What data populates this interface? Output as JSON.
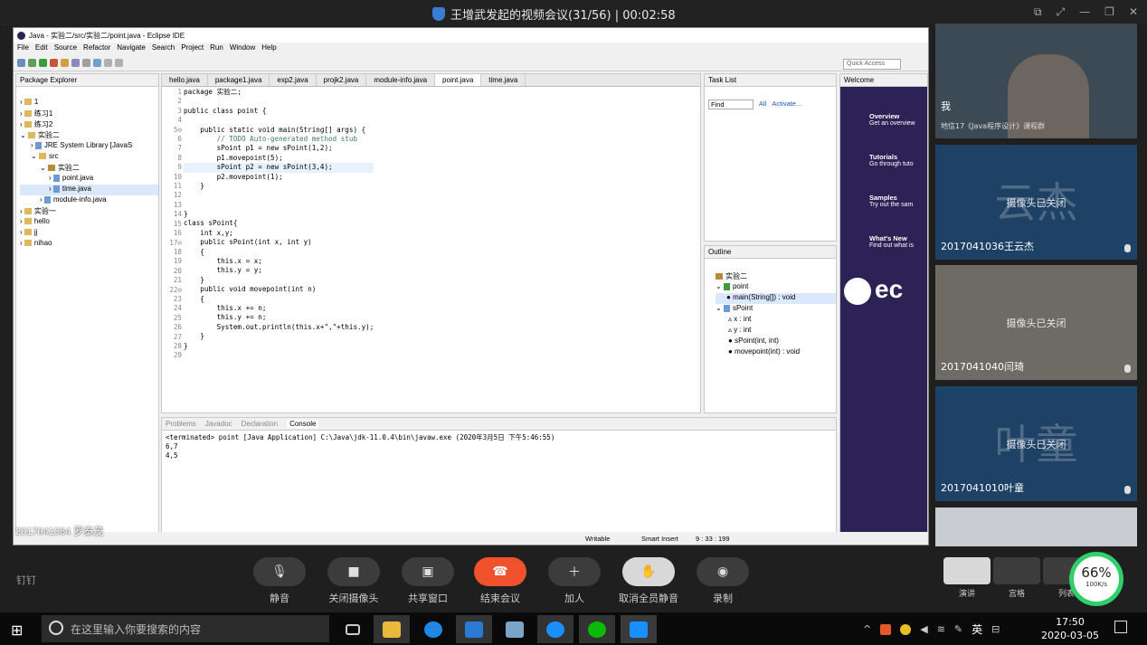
{
  "meeting": {
    "title": "王增武发起的视频会议(31/56) | 00:02:58"
  },
  "eclipse": {
    "window_title": "Java - 实验二/src/实验二/point.java - Eclipse IDE",
    "menu": [
      "File",
      "Edit",
      "Source",
      "Refactor",
      "Navigate",
      "Search",
      "Project",
      "Run",
      "Window",
      "Help"
    ],
    "quick_access": "Quick Access",
    "package_explorer": {
      "title": "Package Explorer",
      "items": [
        "1",
        "练习1",
        "练习2",
        "实验二",
        "JRE System Library [JavaS",
        "src",
        "实验二",
        "point.java",
        "time.java",
        "module-info.java",
        "实验一",
        "hello",
        "jj",
        "nihao"
      ]
    },
    "editor_tabs": [
      "hello.java",
      "package1.java",
      "exp2.java",
      "projk2.java",
      "module-info.java",
      "point.java",
      "time.java"
    ],
    "line_numbers": [
      "1",
      "2",
      "3",
      "4",
      "5⊖",
      "6",
      "7",
      "8",
      "9",
      "10",
      "11",
      "12",
      "13",
      "14",
      "15",
      "16",
      "17⊖",
      "18",
      "19",
      "20",
      "21",
      "22⊖",
      "23",
      "24",
      "25",
      "26",
      "27",
      "28",
      "29"
    ],
    "code": [
      "package 实验二;",
      "",
      "public class point {",
      "",
      "    public static void main(String[] args) {",
      "        // TODO Auto-generated method stub",
      "        sPoint p1 = new sPoint(1,2);",
      "        p1.movepoint(5);",
      "        sPoint p2 = new sPoint(3,4);",
      "        p2.movepoint(1);",
      "    }",
      "",
      "",
      "}",
      "class sPoint{",
      "    int x,y;",
      "    public sPoint(int x, int y)",
      "    {",
      "        this.x = x;",
      "        this.y = y;",
      "    }",
      "    public void movepoint(int n)",
      "    {",
      "        this.x += n;",
      "        this.y += n;",
      "        System.out.println(this.x+\",\"+this.y);",
      "    }",
      "}",
      ""
    ],
    "task_list": {
      "title": "Task List",
      "find": "Find",
      "all": "All",
      "activate": "Activate..."
    },
    "outline": {
      "title": "Outline",
      "items": [
        "实验二",
        "point",
        "main(String[]) : void",
        "sPoint",
        "x : int",
        "y : int",
        "sPoint(int, int)",
        "movepoint(int) : void"
      ]
    },
    "welcome": {
      "title": "Welcome",
      "items": [
        {
          "t": "Overview",
          "d": "Get an overview"
        },
        {
          "t": "Tutorials",
          "d": "Go through tuto"
        },
        {
          "t": "Samples",
          "d": "Try out the sam"
        },
        {
          "t": "What's New",
          "d": "Find out what is"
        }
      ],
      "logo": "ec"
    },
    "bottom_tabs": [
      "Problems",
      "Javadoc",
      "Declaration",
      "Console"
    ],
    "console": {
      "header": "<terminated> point [Java Application] C:\\Java\\jdk-11.0.4\\bin\\javaw.exe (2020年3月5日 下午5:46:55)",
      "lines": [
        "6,7",
        "4,5"
      ]
    },
    "status": {
      "writable": "Writable",
      "insert": "Smart Insert",
      "pos": "9 : 33 : 199"
    }
  },
  "overlay_name": "2017041064 罗泰茂",
  "participants": [
    {
      "name": "我",
      "sub": "地信17《Java程序设计》课程群"
    },
    {
      "name": "2017041036王云杰",
      "big": "云杰",
      "cam": "摄像头已关闭"
    },
    {
      "name": "2017041040闫琦",
      "big": "",
      "cam": "摄像头已关闭"
    },
    {
      "name": "2017041010叶童",
      "big": "叶童",
      "cam": "摄像头已关闭"
    }
  ],
  "controls": [
    {
      "label": "静音",
      "icon": "mic-icon"
    },
    {
      "label": "关闭摄像头",
      "icon": "camera-icon"
    },
    {
      "label": "共享窗口",
      "icon": "share-icon"
    },
    {
      "label": "结束会议",
      "icon": "end-call-icon"
    },
    {
      "label": "加人",
      "icon": "add-person-icon"
    },
    {
      "label": "取消全员静音",
      "icon": "mute-all-icon"
    },
    {
      "label": "录制",
      "icon": "record-icon"
    }
  ],
  "layout_buttons": [
    "演讲",
    "宫格",
    "列表"
  ],
  "dingding": "钉钉",
  "network": {
    "percent": "66%",
    "speed": "100K/s"
  },
  "taskbar": {
    "search": "在这里输入你要搜索的内容",
    "time": "17:50",
    "date": "2020-03-05",
    "ime": "英",
    "colors": {
      "edge": "#1e88e5",
      "wechat": "#09bb07",
      "dingtalk": "#1890ff"
    }
  }
}
